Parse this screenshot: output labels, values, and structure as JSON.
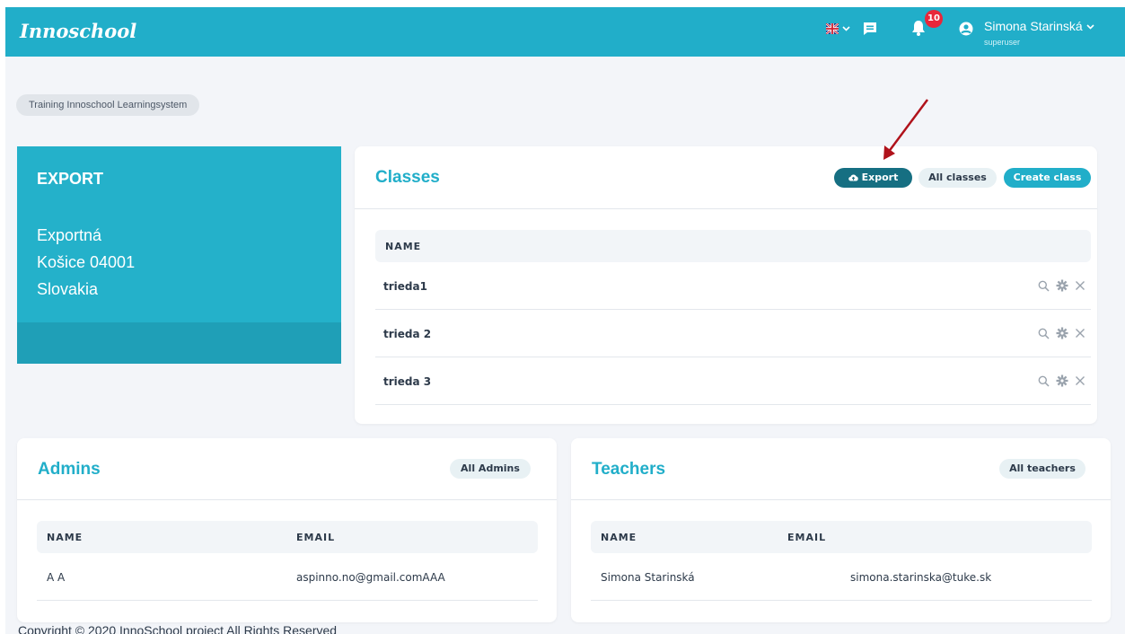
{
  "header": {
    "logo": "Innoschool",
    "notifications_count": "10",
    "user_name": "Simona Starinská",
    "user_role": "superuser"
  },
  "breadcrumb": "Training Innoschool Learningsystem",
  "export_panel": {
    "title": "EXPORT",
    "address_line1": "Exportná",
    "address_line2": "Košice 04001",
    "address_line3": "Slovakia"
  },
  "classes": {
    "title": "Classes",
    "export_label": "Export",
    "all_label": "All classes",
    "create_label": "Create class",
    "col_name": "NAME",
    "rows": [
      "trieda1",
      "trieda 2",
      "trieda 3"
    ]
  },
  "admins": {
    "title": "Admins",
    "all_label": "All Admins",
    "col_name": "NAME",
    "col_email": "EMAIL",
    "rows": [
      {
        "name": "A A",
        "email": "aspinno.no@gmail.comAAA"
      }
    ]
  },
  "teachers": {
    "title": "Teachers",
    "all_label": "All teachers",
    "col_name": "NAME",
    "col_email": "EMAIL",
    "rows": [
      {
        "name": "Simona Starinská",
        "email": "simona.starinska@tuke.sk"
      }
    ]
  },
  "footer": "Copyright © 2020 InnoSchool project All Rights Reserved",
  "colors": {
    "accent": "#21aec9",
    "export_button": "#166f82",
    "badge": "#e8263a",
    "annotation_arrow": "#b0121b"
  }
}
